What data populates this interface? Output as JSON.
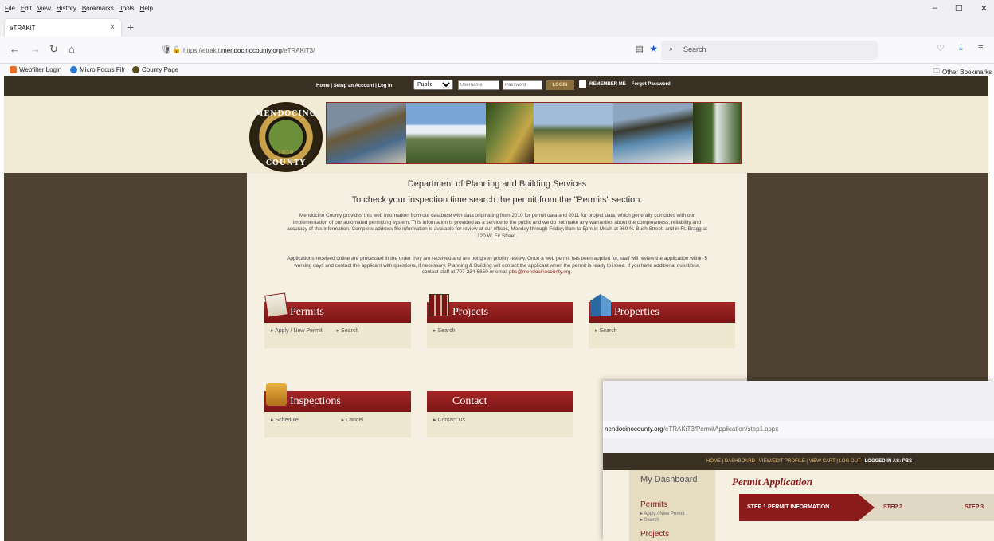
{
  "browser": {
    "menus": [
      "File",
      "Edit",
      "View",
      "History",
      "Bookmarks",
      "Tools",
      "Help"
    ],
    "tab_title": "eTRAKiT",
    "url_prefix": "https://etrakit.",
    "url_domain": "mendocinocounty.org",
    "url_path": "/eTRAKiT3/",
    "search_placeholder": "Search",
    "bookmarks": [
      "Webfilter Login",
      "Micro Focus Filr",
      "County Page"
    ],
    "other_bookmarks": "Other Bookmarks"
  },
  "topnav": {
    "links": "Home  |  Setup an Account  |  Log In",
    "select_value": "Public",
    "username_placeholder": "Username",
    "password_placeholder": "Password",
    "login_label": "LOGIN",
    "remember": "REMEMBER ME",
    "forgot": "Forgot Password"
  },
  "seal": {
    "top": "MENDOCINO",
    "bottom": "COUNTY",
    "year": "1850"
  },
  "main": {
    "dept": "Department of Planning and Building Services",
    "notice": "To check your inspection time search the permit from the \"Permits\" section.",
    "para1": "Mendocino County provides this web information from our database with data originating from 2010 for permit data and 2011 for project data, which generally coincides with our implementation of our automated permitting system. This information is provided as a service to the public and we do not make any warranties about the completeness, reliability and accuracy of this information. Complete address file information is available for review at our offices, Monday through Friday, 8am to 5pm in Ukiah at 860 N. Bush Street, and in Ft. Bragg at 120 W. Fir Street.",
    "para2a": "Applications received online are processed in the order they are received and are ",
    "para2_not": "not",
    "para2b": " given priority review. Once a web permit has been applied for, staff will review the application within 5 working days and contact the applicant with questions, if necessary. Planning & Building will contact the applicant when the permit is ready to issue. If you have additional questions, contact staff at 707-234-6650 or email ",
    "para2_email": "pbs@mendocinocounty.org",
    "para2_end": ".",
    "cards": {
      "permits": {
        "title": "Permits",
        "links": [
          "Apply / New Permit",
          "Search"
        ]
      },
      "projects": {
        "title": "Projects",
        "links": [
          "Search"
        ]
      },
      "properties": {
        "title": "Properties",
        "links": [
          "Search"
        ]
      },
      "inspections": {
        "title": "Inspections",
        "links": [
          "Schedule",
          "Cancel"
        ]
      },
      "contact": {
        "title": "Contact",
        "links": [
          "Contact Us"
        ]
      }
    }
  },
  "overlay": {
    "url_start": "nendocinocounty.org",
    "url_rest": "/eTRAKiT3/PermitApplication/step1.aspx",
    "nav": "HOME  |  DASHBOARD  |  VIEW/EDIT PROFILE  |  VIEW CART  |  LOG OUT",
    "logged_in": "LOGGED IN AS:  PBS",
    "dashboard": "My Dashboard",
    "permits": "Permits",
    "permit_sub": [
      "Apply / New Permit",
      "Search"
    ],
    "projects": "Projects",
    "title": "Permit Application",
    "steps": [
      "STEP 1  PERMIT INFORMATION",
      "STEP 2",
      "STEP 3"
    ]
  },
  "colors": {
    "accent": "#8b1a1a",
    "page_bg": "#4e4331",
    "content_bg": "#f5f0e1"
  }
}
